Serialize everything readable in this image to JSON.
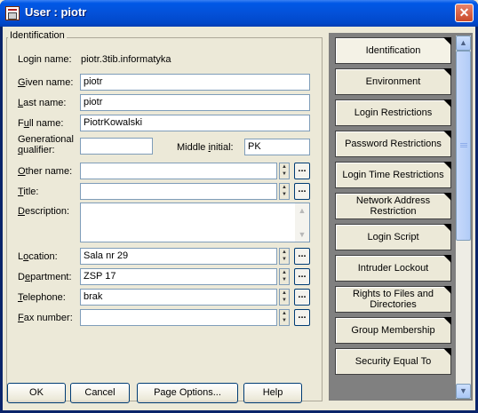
{
  "window": {
    "title": "User : piotr"
  },
  "identification": {
    "group_label": "Identification",
    "login_name": {
      "label": "Login name:",
      "value": "piotr.3tib.informatyka"
    },
    "given_name": {
      "label_pre": "",
      "label_u": "G",
      "label_post": "iven name:",
      "value": "piotr"
    },
    "last_name": {
      "label_pre": "",
      "label_u": "L",
      "label_post": "ast name:",
      "value": "piotr"
    },
    "full_name": {
      "label_pre": "F",
      "label_u": "u",
      "label_post": "ll name:",
      "value": "PiotrKowalski"
    },
    "generational_qualifier": {
      "label_line1": "Generational",
      "label_line2_u": "q",
      "label_line2_post": "ualifier:",
      "value": ""
    },
    "middle_initial": {
      "label_pre": "Middle ",
      "label_u": "i",
      "label_post": "nitial:",
      "value": "PK"
    },
    "other_name": {
      "label_pre": "",
      "label_u": "O",
      "label_post": "ther name:",
      "value": ""
    },
    "title": {
      "label_pre": "",
      "label_u": "T",
      "label_post": "itle:",
      "value": ""
    },
    "description": {
      "label_pre": "",
      "label_u": "D",
      "label_post": "escription:",
      "value": ""
    },
    "location": {
      "label_pre": "L",
      "label_u": "o",
      "label_post": "cation:",
      "value": "Sala nr 29"
    },
    "department": {
      "label_pre": "D",
      "label_u": "e",
      "label_post": "partment:",
      "value": "ZSP 17"
    },
    "telephone": {
      "label_pre": "",
      "label_u": "T",
      "label_post": "elephone:",
      "value": "brak"
    },
    "fax_number": {
      "label_pre": "",
      "label_u": "F",
      "label_post": "ax number:",
      "value": ""
    },
    "browse_label": "..."
  },
  "side_tabs": [
    "Identification",
    "Environment",
    "Login Restrictions",
    "Password Restrictions",
    "Login Time Restrictions",
    "Network Address Restriction",
    "Login Script",
    "Intruder Lockout",
    "Rights to Files and Directories",
    "Group Membership",
    "Security Equal To"
  ],
  "buttons": {
    "ok": "OK",
    "cancel": "Cancel",
    "page_options": "Page Options...",
    "help": "Help"
  },
  "icons": {
    "title": "user-window-icon",
    "close": "close-icon",
    "spin_up": "arrow-up-icon",
    "spin_down": "arrow-down-icon"
  }
}
